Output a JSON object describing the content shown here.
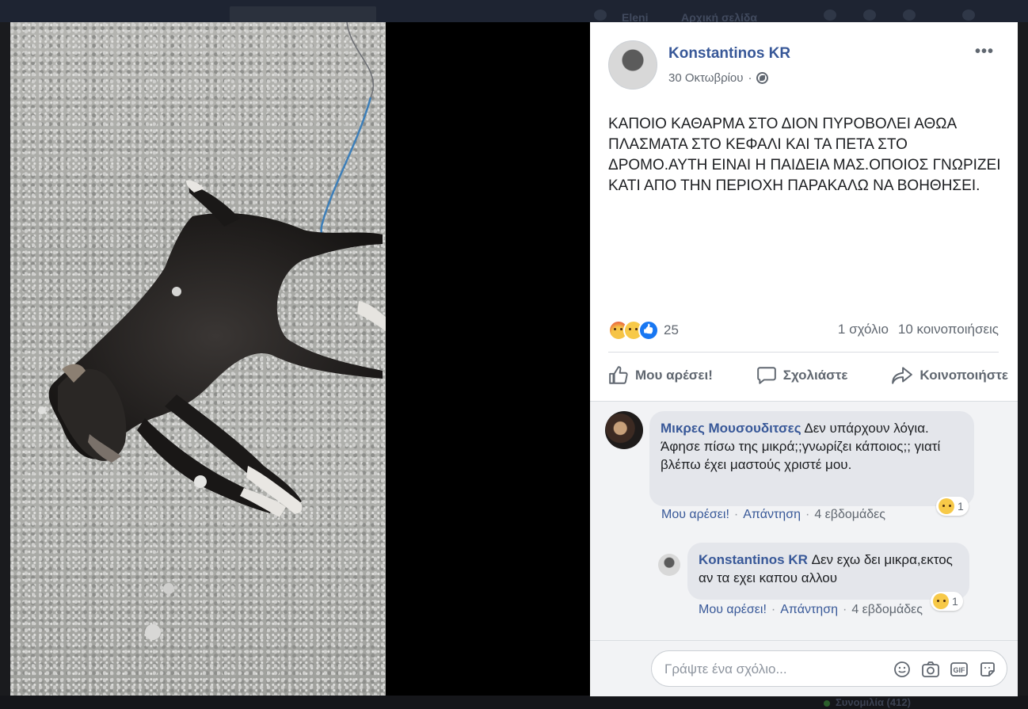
{
  "background": {
    "topbar_items": [
      "Eleni",
      "Αρχική σελίδα"
    ],
    "bottom_label": "Συνομιλία (412)"
  },
  "post": {
    "author": "Konstantinos KR",
    "date": "30 Οκτωβρίου",
    "date_separator": "·",
    "more_label": "•••",
    "text": "ΚΑΠΟΙΟ ΚΑΘΑΡΜΑ ΣΤΟ ΔΙΟΝ ΠΥΡΟΒΟΛΕΙ ΑΘΩΑ ΠΛΑΣΜΑΤΑ ΣΤΟ ΚΕΦΑΛΙ ΚΑΙ ΤΑ ΠΕΤΑ ΣΤΟ ΔΡΟΜΟ.ΑΥΤΗ ΕΙΝΑΙ Η ΠΑΙΔΕΙΑ ΜΑΣ.ΟΠΟΙΟΣ ΓΝΩΡΙΖΕΙ ΚΑΤΙ ΑΠΟ ΤΗΝ ΠΕΡΙΟΧΗ ΠΑΡΑΚΑΛΩ ΝΑ ΒΟΗΘΗΣΕΙ.",
    "reaction_count": "25",
    "reaction_icons": [
      "angry-icon",
      "sad-icon",
      "like-icon"
    ],
    "comments_count": "1 σχόλιο",
    "shares_count": "10 κοινοποιήσεις"
  },
  "actions": {
    "like": "Μου αρέσει!",
    "comment": "Σχολιάστε",
    "share": "Κοινοποιήστε"
  },
  "comments": [
    {
      "author": "Μικρες Μουσουδιτσες",
      "text_first": "Δεν υπάρχουν λόγια.",
      "text_second": "Άφησε πίσω της μικρά;;γνωρίζει κάποιος;; γιατί βλέπω έχει μαστούς χριστέ μου.",
      "like": "Μου αρέσει!",
      "reply": "Απάντηση",
      "time": "4 εβδομάδες",
      "reaction_count": "1",
      "separator": "·"
    },
    {
      "author": "Konstantinos KR",
      "text": "Δεν εχω δει μικρα,εκτος αν τα εχει καπου αλλου",
      "like": "Μου αρέσει!",
      "reply": "Απάντηση",
      "time": "4 εβδομάδες",
      "reaction_count": "1",
      "separator": "·"
    }
  ],
  "compose": {
    "placeholder": "Γράψτε ένα σχόλιο...",
    "icons": [
      "emoji-icon",
      "camera-icon",
      "gif-icon",
      "sticker-icon"
    ],
    "gif_label": "GIF"
  },
  "colors": {
    "link": "#385898",
    "meta": "#606770",
    "bubble": "#e4e6eb",
    "like_blue": "#1877f2"
  }
}
